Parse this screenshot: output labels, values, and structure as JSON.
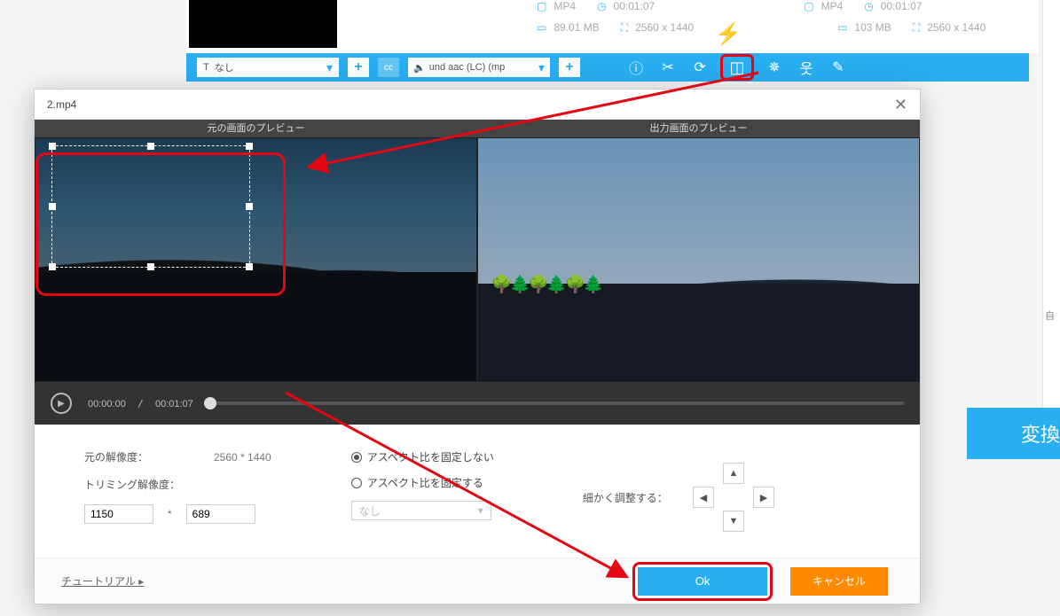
{
  "background": {
    "file": {
      "src_format": "MP4",
      "src_duration": "00:01:07",
      "src_size": "89.01 MB",
      "src_dimensions": "2560 x 1440",
      "dst_format": "MP4",
      "dst_duration": "00:01:07",
      "dst_size": "103 MB",
      "dst_dimensions": "2560 x 1440"
    },
    "toolbar": {
      "subtitle_selector": "なし",
      "audio_selector": "und aac (LC) (mp",
      "cc_label": "cc"
    },
    "icons": [
      "info-icon",
      "scissors-icon",
      "rotate-icon",
      "crop-icon",
      "fx-icon",
      "watermark-icon",
      "edit-icon"
    ],
    "side": {
      "auto_label": "自"
    },
    "convert_label": "変換"
  },
  "modal": {
    "filename": "2.mp4",
    "preview_left_title": "元の画面のプレビュー",
    "preview_right_title": "出力画面のプレビュー",
    "playback": {
      "current": "00:00:00",
      "total": "00:01:07"
    },
    "settings": {
      "orig_res_label": "元の解像度：",
      "orig_res_value": "2560 * 1440",
      "trim_res_label": "トリミング解像度：",
      "trim_w": "1150",
      "trim_h": "689",
      "aspect_free_label": "アスペクト比を固定しない",
      "aspect_lock_label": "アスペクト比を固定する",
      "aspect_selector": "なし",
      "fine_label": "細かく調整する："
    },
    "footer": {
      "tutorial": "チュートリアル ▸",
      "ok": "Ok",
      "cancel": "キャンセル"
    }
  }
}
